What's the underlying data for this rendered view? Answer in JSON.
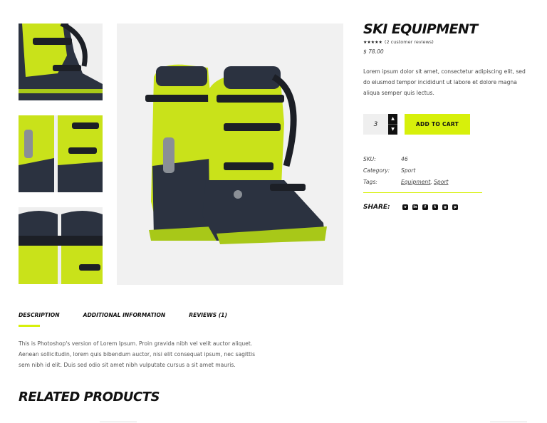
{
  "product": {
    "title": "SKI EQUIPMENT",
    "stars": "★★★★★",
    "reviews_text": "(2 customer reviews)",
    "price": "$ 78.00",
    "description": "Lorem ipsum dolor sit amet, consectetur adipiscing elit, sed do eiusmod tempor incididunt ut labore et dolore magna aliqua semper quis lectus."
  },
  "cart": {
    "quantity": "3",
    "add_to_cart_label": "ADD TO CART"
  },
  "meta": {
    "sku_label": "SKU:",
    "sku_value": "46",
    "category_label": "Category:",
    "category_value": "Sport",
    "tags_label": "Tags:",
    "tags": [
      "Equipment",
      "Sport"
    ],
    "tag_separator": ","
  },
  "share": {
    "label": "SHARE:",
    "icons": [
      "v",
      "in",
      "f",
      "t",
      "g",
      "p"
    ]
  },
  "tabs": [
    {
      "label": "DESCRIPTION"
    },
    {
      "label": "ADDITIONAL INFORMATION"
    },
    {
      "label": "REVIEWS (1)"
    }
  ],
  "tab_content": "This is Photoshop's version  of Lorem Ipsum. Proin gravida nibh vel velit auctor aliquet. Aenean sollicitudin, lorem quis bibendum auctor, nisi elit consequat ipsum, nec sagittis sem nibh id elit. Duis sed odio sit amet nibh vulputate cursus a sit amet mauris.",
  "related_title": "RELATED PRODUCTS",
  "colors": {
    "accent": "#d7f00b",
    "boot_yellow": "#c9e21a",
    "boot_dark": "#2b3240"
  }
}
